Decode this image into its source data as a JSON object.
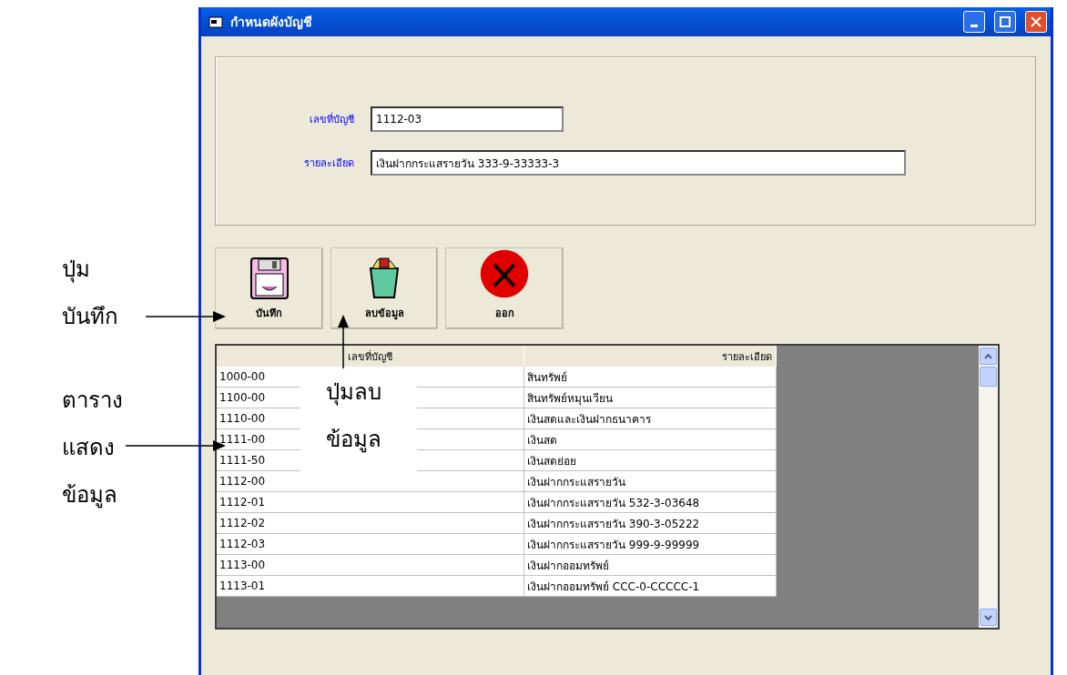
{
  "annotations": {
    "save_button": [
      "ปุ่ม",
      "บันทึก"
    ],
    "table": [
      "ตาราง",
      "แสดง",
      "ข้อมูล"
    ],
    "delete_button": [
      "ปุ่มลบ",
      "ข้อมูล"
    ]
  },
  "window": {
    "title": "กำหนดผังบัญชี"
  },
  "form": {
    "fields": [
      {
        "label": "เลขที่บัญชี",
        "value": "1112-03",
        "kind": "short"
      },
      {
        "label": "รายละเอียด",
        "value": "เงินฝากกระแสรายวัน 333-9-33333-3",
        "kind": "long"
      }
    ]
  },
  "toolbar": [
    {
      "label": "บันทึก",
      "kind": "save"
    },
    {
      "label": "ลบข้อมูล",
      "kind": "delete"
    },
    {
      "label": "ออก",
      "kind": "exit"
    }
  ],
  "table": {
    "columns": [
      "เลขที่บัญชี",
      "รายละเอียด"
    ],
    "rows": [
      [
        "1000-00",
        "สินทรัพย์"
      ],
      [
        "1100-00",
        "สินทรัพย์หมุนเวียน"
      ],
      [
        "1110-00",
        "เงินสดและเงินฝากธนาคาร"
      ],
      [
        "1111-00",
        "เงินสด"
      ],
      [
        "1111-50",
        "เงินสดย่อย"
      ],
      [
        "1112-00",
        "เงินฝากกระแสรายวัน"
      ],
      [
        "1112-01",
        "เงินฝากกระแสรายวัน 532-3-03648"
      ],
      [
        "1112-02",
        "เงินฝากกระแสรายวัน 390-3-05222"
      ],
      [
        "1112-03",
        "เงินฝากกระแสรายวัน 999-9-99999"
      ],
      [
        "1113-00",
        "เงินฝากออมทรัพย์"
      ],
      [
        "1113-01",
        "เงินฝากออมทรัพย์ CCC-0-CCCCC-1"
      ]
    ]
  }
}
